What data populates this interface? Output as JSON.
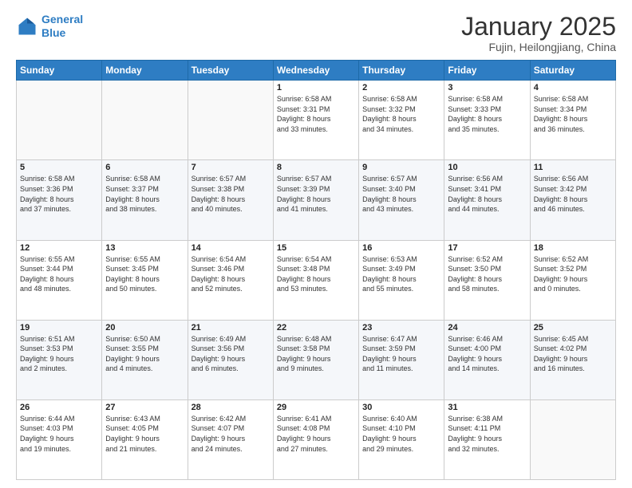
{
  "header": {
    "logo_line1": "General",
    "logo_line2": "Blue",
    "main_title": "January 2025",
    "subtitle": "Fujin, Heilongjiang, China"
  },
  "days_of_week": [
    "Sunday",
    "Monday",
    "Tuesday",
    "Wednesday",
    "Thursday",
    "Friday",
    "Saturday"
  ],
  "weeks": [
    {
      "days": [
        {
          "number": "",
          "info": ""
        },
        {
          "number": "",
          "info": ""
        },
        {
          "number": "",
          "info": ""
        },
        {
          "number": "1",
          "info": "Sunrise: 6:58 AM\nSunset: 3:31 PM\nDaylight: 8 hours\nand 33 minutes."
        },
        {
          "number": "2",
          "info": "Sunrise: 6:58 AM\nSunset: 3:32 PM\nDaylight: 8 hours\nand 34 minutes."
        },
        {
          "number": "3",
          "info": "Sunrise: 6:58 AM\nSunset: 3:33 PM\nDaylight: 8 hours\nand 35 minutes."
        },
        {
          "number": "4",
          "info": "Sunrise: 6:58 AM\nSunset: 3:34 PM\nDaylight: 8 hours\nand 36 minutes."
        }
      ]
    },
    {
      "days": [
        {
          "number": "5",
          "info": "Sunrise: 6:58 AM\nSunset: 3:36 PM\nDaylight: 8 hours\nand 37 minutes."
        },
        {
          "number": "6",
          "info": "Sunrise: 6:58 AM\nSunset: 3:37 PM\nDaylight: 8 hours\nand 38 minutes."
        },
        {
          "number": "7",
          "info": "Sunrise: 6:57 AM\nSunset: 3:38 PM\nDaylight: 8 hours\nand 40 minutes."
        },
        {
          "number": "8",
          "info": "Sunrise: 6:57 AM\nSunset: 3:39 PM\nDaylight: 8 hours\nand 41 minutes."
        },
        {
          "number": "9",
          "info": "Sunrise: 6:57 AM\nSunset: 3:40 PM\nDaylight: 8 hours\nand 43 minutes."
        },
        {
          "number": "10",
          "info": "Sunrise: 6:56 AM\nSunset: 3:41 PM\nDaylight: 8 hours\nand 44 minutes."
        },
        {
          "number": "11",
          "info": "Sunrise: 6:56 AM\nSunset: 3:42 PM\nDaylight: 8 hours\nand 46 minutes."
        }
      ]
    },
    {
      "days": [
        {
          "number": "12",
          "info": "Sunrise: 6:55 AM\nSunset: 3:44 PM\nDaylight: 8 hours\nand 48 minutes."
        },
        {
          "number": "13",
          "info": "Sunrise: 6:55 AM\nSunset: 3:45 PM\nDaylight: 8 hours\nand 50 minutes."
        },
        {
          "number": "14",
          "info": "Sunrise: 6:54 AM\nSunset: 3:46 PM\nDaylight: 8 hours\nand 52 minutes."
        },
        {
          "number": "15",
          "info": "Sunrise: 6:54 AM\nSunset: 3:48 PM\nDaylight: 8 hours\nand 53 minutes."
        },
        {
          "number": "16",
          "info": "Sunrise: 6:53 AM\nSunset: 3:49 PM\nDaylight: 8 hours\nand 55 minutes."
        },
        {
          "number": "17",
          "info": "Sunrise: 6:52 AM\nSunset: 3:50 PM\nDaylight: 8 hours\nand 58 minutes."
        },
        {
          "number": "18",
          "info": "Sunrise: 6:52 AM\nSunset: 3:52 PM\nDaylight: 9 hours\nand 0 minutes."
        }
      ]
    },
    {
      "days": [
        {
          "number": "19",
          "info": "Sunrise: 6:51 AM\nSunset: 3:53 PM\nDaylight: 9 hours\nand 2 minutes."
        },
        {
          "number": "20",
          "info": "Sunrise: 6:50 AM\nSunset: 3:55 PM\nDaylight: 9 hours\nand 4 minutes."
        },
        {
          "number": "21",
          "info": "Sunrise: 6:49 AM\nSunset: 3:56 PM\nDaylight: 9 hours\nand 6 minutes."
        },
        {
          "number": "22",
          "info": "Sunrise: 6:48 AM\nSunset: 3:58 PM\nDaylight: 9 hours\nand 9 minutes."
        },
        {
          "number": "23",
          "info": "Sunrise: 6:47 AM\nSunset: 3:59 PM\nDaylight: 9 hours\nand 11 minutes."
        },
        {
          "number": "24",
          "info": "Sunrise: 6:46 AM\nSunset: 4:00 PM\nDaylight: 9 hours\nand 14 minutes."
        },
        {
          "number": "25",
          "info": "Sunrise: 6:45 AM\nSunset: 4:02 PM\nDaylight: 9 hours\nand 16 minutes."
        }
      ]
    },
    {
      "days": [
        {
          "number": "26",
          "info": "Sunrise: 6:44 AM\nSunset: 4:03 PM\nDaylight: 9 hours\nand 19 minutes."
        },
        {
          "number": "27",
          "info": "Sunrise: 6:43 AM\nSunset: 4:05 PM\nDaylight: 9 hours\nand 21 minutes."
        },
        {
          "number": "28",
          "info": "Sunrise: 6:42 AM\nSunset: 4:07 PM\nDaylight: 9 hours\nand 24 minutes."
        },
        {
          "number": "29",
          "info": "Sunrise: 6:41 AM\nSunset: 4:08 PM\nDaylight: 9 hours\nand 27 minutes."
        },
        {
          "number": "30",
          "info": "Sunrise: 6:40 AM\nSunset: 4:10 PM\nDaylight: 9 hours\nand 29 minutes."
        },
        {
          "number": "31",
          "info": "Sunrise: 6:38 AM\nSunset: 4:11 PM\nDaylight: 9 hours\nand 32 minutes."
        },
        {
          "number": "",
          "info": ""
        }
      ]
    }
  ]
}
